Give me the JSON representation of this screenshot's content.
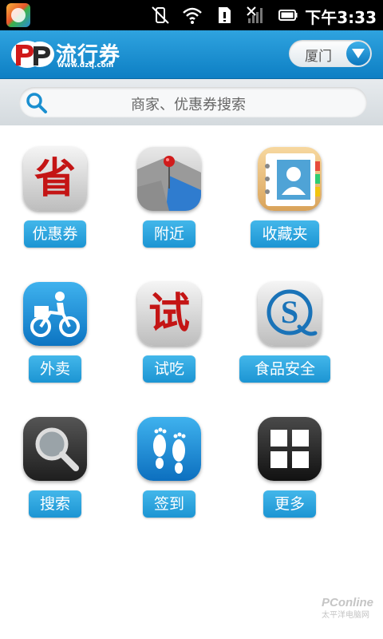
{
  "status_bar": {
    "time": "下午3:33",
    "icons": [
      "app-store-icon",
      "no-vibrate-icon",
      "wifi-icon",
      "sim-card-icon",
      "no-signal-icon",
      "battery-icon"
    ]
  },
  "header": {
    "app_name": "流行券",
    "app_url": "www.dzq.com",
    "city": "厦门"
  },
  "search": {
    "placeholder": "商家、优惠券搜索"
  },
  "grid": [
    {
      "label": "优惠券",
      "icon": "save-money-icon",
      "glyph": "省"
    },
    {
      "label": "附近",
      "icon": "map-pin-icon"
    },
    {
      "label": "收藏夹",
      "icon": "address-book-icon"
    },
    {
      "label": "外卖",
      "icon": "delivery-bike-icon"
    },
    {
      "label": "试吃",
      "icon": "tasting-icon",
      "glyph": "试"
    },
    {
      "label": "食品安全",
      "icon": "food-safety-icon",
      "glyph": "S"
    },
    {
      "label": "搜索",
      "icon": "magnifier-icon"
    },
    {
      "label": "签到",
      "icon": "footprints-icon"
    },
    {
      "label": "更多",
      "icon": "more-grid-icon"
    }
  ],
  "watermark": {
    "brand": "PConline",
    "sub": "太平洋电脑网"
  },
  "colors": {
    "header_blue": "#1a90d2",
    "label_blue": "#2aa3dd",
    "accent_red": "#c41515"
  }
}
